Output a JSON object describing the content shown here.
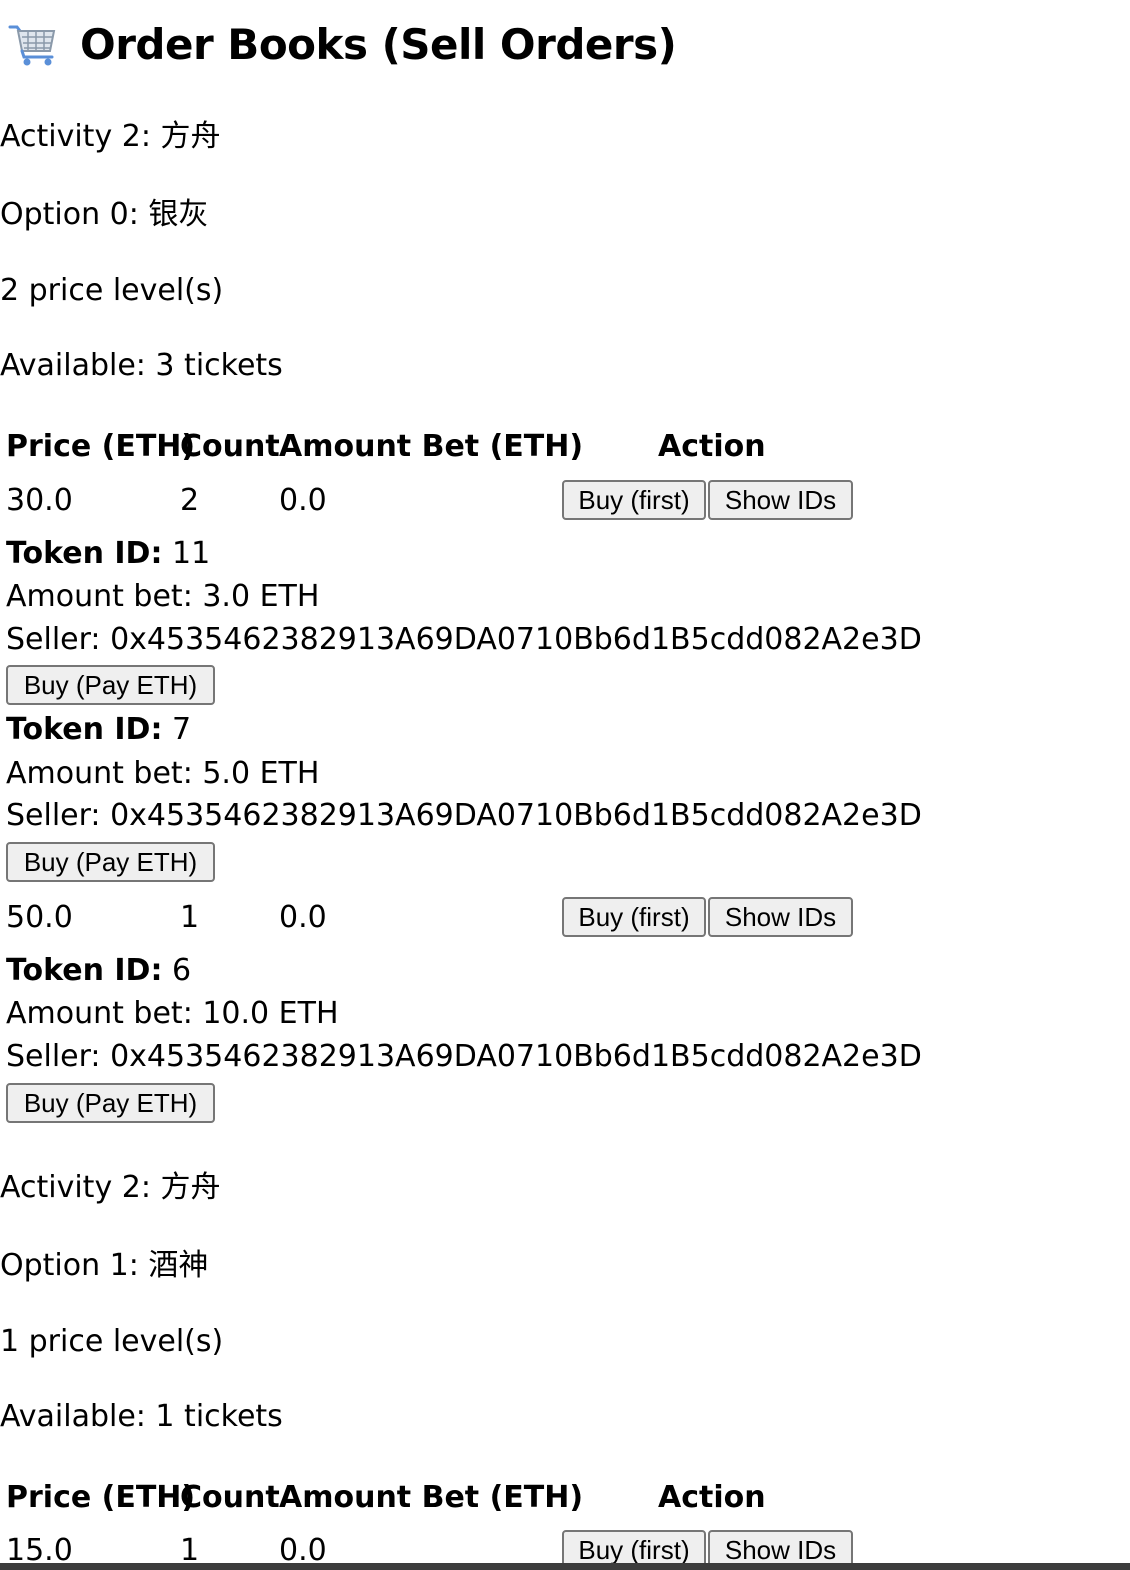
{
  "page_title": "Order Books (Sell Orders)",
  "icons": {
    "title_icon": "shopping-cart-icon"
  },
  "table_headers": {
    "price": "Price (ETH)",
    "count": "Count",
    "amount_bet": "Amount Bet (ETH)",
    "action": "Action"
  },
  "buttons": {
    "buy_first": "Buy (first)",
    "show_ids": "Show IDs",
    "buy_pay": "Buy (Pay ETH)"
  },
  "labels": {
    "token_id": "Token ID:"
  },
  "books": [
    {
      "activity": "Activity 2: 方舟",
      "option": "Option 0: 银灰",
      "levels": "2 price level(s)",
      "available": "Available: 3 tickets",
      "rows": [
        {
          "price": "30.0",
          "count": "2",
          "amount_bet": "0.0",
          "tokens": [
            {
              "id": "11",
              "amount": "Amount bet: 3.0 ETH",
              "seller": "Seller: 0x4535462382913A69DA0710Bb6d1B5cdd082A2e3D"
            },
            {
              "id": "7",
              "amount": "Amount bet: 5.0 ETH",
              "seller": "Seller: 0x4535462382913A69DA0710Bb6d1B5cdd082A2e3D"
            }
          ]
        },
        {
          "price": "50.0",
          "count": "1",
          "amount_bet": "0.0",
          "tokens": [
            {
              "id": "6",
              "amount": "Amount bet: 10.0 ETH",
              "seller": "Seller: 0x4535462382913A69DA0710Bb6d1B5cdd082A2e3D"
            }
          ]
        }
      ]
    },
    {
      "activity": "Activity 2: 方舟",
      "option": "Option 1: 酒神",
      "levels": "1 price level(s)",
      "available": "Available: 1 tickets",
      "rows": [
        {
          "price": "15.0",
          "count": "1",
          "amount_bet": "0.0",
          "tokens": []
        }
      ]
    }
  ]
}
